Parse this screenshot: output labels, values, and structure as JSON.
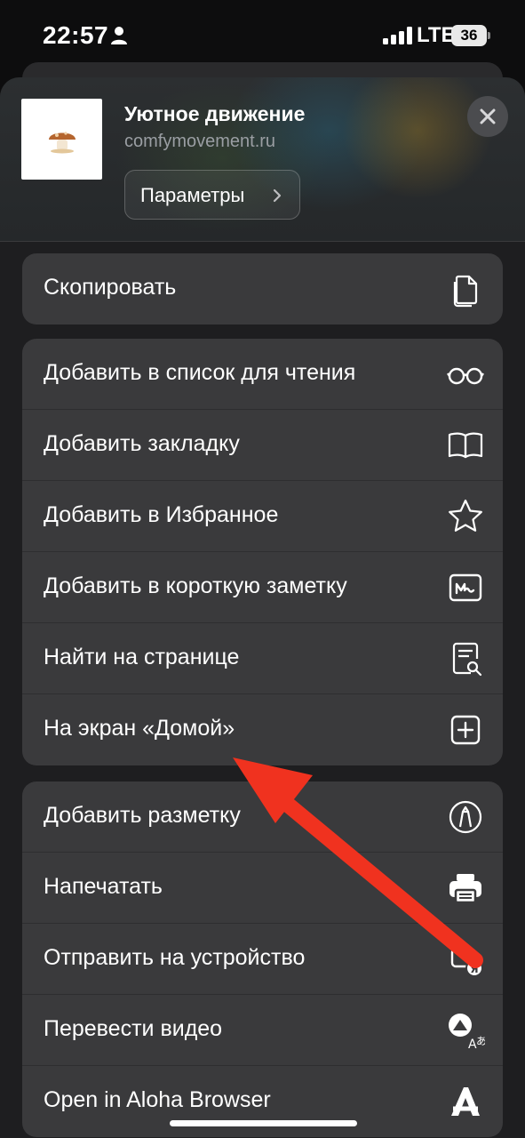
{
  "status_bar": {
    "time": "22:57",
    "network": "LTE",
    "battery": "36"
  },
  "header": {
    "title": "Уютное движение",
    "url": "comfymovement.ru",
    "params_label": "Параметры"
  },
  "groups": {
    "copy": {
      "label": "Скопировать",
      "icon": "copy-icon"
    },
    "main": [
      {
        "label": "Добавить в список для чтения",
        "icon": "glasses-icon"
      },
      {
        "label": "Добавить закладку",
        "icon": "book-icon"
      },
      {
        "label": "Добавить в Избранное",
        "icon": "star-icon"
      },
      {
        "label": "Добавить в короткую заметку",
        "icon": "quick-note-icon"
      },
      {
        "label": "Найти на странице",
        "icon": "find-in-page-icon"
      },
      {
        "label": "На экран «Домой»",
        "icon": "add-square-icon"
      }
    ],
    "extra": [
      {
        "label": "Добавить разметку",
        "icon": "markup-icon"
      },
      {
        "label": "Напечатать",
        "icon": "printer-icon"
      },
      {
        "label": "Отправить на устройство",
        "icon": "send-to-device-icon"
      },
      {
        "label": "Перевести видео",
        "icon": "translate-video-icon"
      },
      {
        "label": "Open in Aloha Browser",
        "icon": "aloha-icon"
      }
    ]
  },
  "colors": {
    "annotation_arrow": "#f0321f",
    "cell_bg": "#3a3a3c"
  }
}
